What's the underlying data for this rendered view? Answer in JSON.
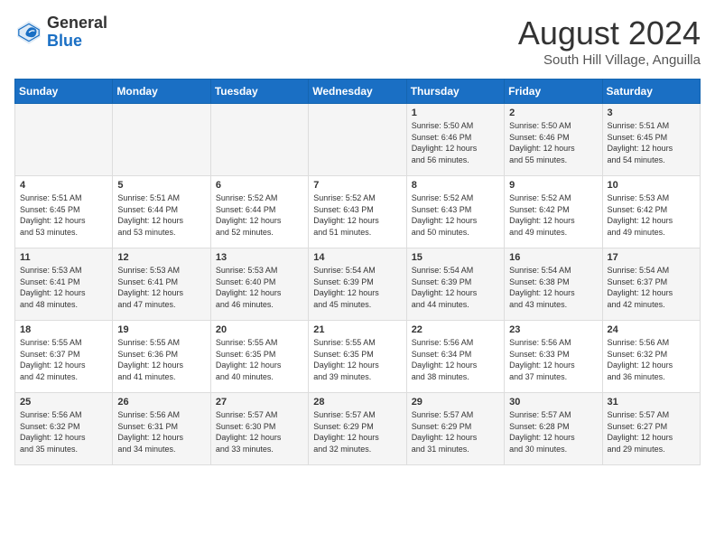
{
  "header": {
    "logo_general": "General",
    "logo_blue": "Blue",
    "month_year": "August 2024",
    "location": "South Hill Village, Anguilla"
  },
  "days_of_week": [
    "Sunday",
    "Monday",
    "Tuesday",
    "Wednesday",
    "Thursday",
    "Friday",
    "Saturday"
  ],
  "weeks": [
    [
      {
        "day": "",
        "info": ""
      },
      {
        "day": "",
        "info": ""
      },
      {
        "day": "",
        "info": ""
      },
      {
        "day": "",
        "info": ""
      },
      {
        "day": "1",
        "info": "Sunrise: 5:50 AM\nSunset: 6:46 PM\nDaylight: 12 hours\nand 56 minutes."
      },
      {
        "day": "2",
        "info": "Sunrise: 5:50 AM\nSunset: 6:46 PM\nDaylight: 12 hours\nand 55 minutes."
      },
      {
        "day": "3",
        "info": "Sunrise: 5:51 AM\nSunset: 6:45 PM\nDaylight: 12 hours\nand 54 minutes."
      }
    ],
    [
      {
        "day": "4",
        "info": "Sunrise: 5:51 AM\nSunset: 6:45 PM\nDaylight: 12 hours\nand 53 minutes."
      },
      {
        "day": "5",
        "info": "Sunrise: 5:51 AM\nSunset: 6:44 PM\nDaylight: 12 hours\nand 53 minutes."
      },
      {
        "day": "6",
        "info": "Sunrise: 5:52 AM\nSunset: 6:44 PM\nDaylight: 12 hours\nand 52 minutes."
      },
      {
        "day": "7",
        "info": "Sunrise: 5:52 AM\nSunset: 6:43 PM\nDaylight: 12 hours\nand 51 minutes."
      },
      {
        "day": "8",
        "info": "Sunrise: 5:52 AM\nSunset: 6:43 PM\nDaylight: 12 hours\nand 50 minutes."
      },
      {
        "day": "9",
        "info": "Sunrise: 5:52 AM\nSunset: 6:42 PM\nDaylight: 12 hours\nand 49 minutes."
      },
      {
        "day": "10",
        "info": "Sunrise: 5:53 AM\nSunset: 6:42 PM\nDaylight: 12 hours\nand 49 minutes."
      }
    ],
    [
      {
        "day": "11",
        "info": "Sunrise: 5:53 AM\nSunset: 6:41 PM\nDaylight: 12 hours\nand 48 minutes."
      },
      {
        "day": "12",
        "info": "Sunrise: 5:53 AM\nSunset: 6:41 PM\nDaylight: 12 hours\nand 47 minutes."
      },
      {
        "day": "13",
        "info": "Sunrise: 5:53 AM\nSunset: 6:40 PM\nDaylight: 12 hours\nand 46 minutes."
      },
      {
        "day": "14",
        "info": "Sunrise: 5:54 AM\nSunset: 6:39 PM\nDaylight: 12 hours\nand 45 minutes."
      },
      {
        "day": "15",
        "info": "Sunrise: 5:54 AM\nSunset: 6:39 PM\nDaylight: 12 hours\nand 44 minutes."
      },
      {
        "day": "16",
        "info": "Sunrise: 5:54 AM\nSunset: 6:38 PM\nDaylight: 12 hours\nand 43 minutes."
      },
      {
        "day": "17",
        "info": "Sunrise: 5:54 AM\nSunset: 6:37 PM\nDaylight: 12 hours\nand 42 minutes."
      }
    ],
    [
      {
        "day": "18",
        "info": "Sunrise: 5:55 AM\nSunset: 6:37 PM\nDaylight: 12 hours\nand 42 minutes."
      },
      {
        "day": "19",
        "info": "Sunrise: 5:55 AM\nSunset: 6:36 PM\nDaylight: 12 hours\nand 41 minutes."
      },
      {
        "day": "20",
        "info": "Sunrise: 5:55 AM\nSunset: 6:35 PM\nDaylight: 12 hours\nand 40 minutes."
      },
      {
        "day": "21",
        "info": "Sunrise: 5:55 AM\nSunset: 6:35 PM\nDaylight: 12 hours\nand 39 minutes."
      },
      {
        "day": "22",
        "info": "Sunrise: 5:56 AM\nSunset: 6:34 PM\nDaylight: 12 hours\nand 38 minutes."
      },
      {
        "day": "23",
        "info": "Sunrise: 5:56 AM\nSunset: 6:33 PM\nDaylight: 12 hours\nand 37 minutes."
      },
      {
        "day": "24",
        "info": "Sunrise: 5:56 AM\nSunset: 6:32 PM\nDaylight: 12 hours\nand 36 minutes."
      }
    ],
    [
      {
        "day": "25",
        "info": "Sunrise: 5:56 AM\nSunset: 6:32 PM\nDaylight: 12 hours\nand 35 minutes."
      },
      {
        "day": "26",
        "info": "Sunrise: 5:56 AM\nSunset: 6:31 PM\nDaylight: 12 hours\nand 34 minutes."
      },
      {
        "day": "27",
        "info": "Sunrise: 5:57 AM\nSunset: 6:30 PM\nDaylight: 12 hours\nand 33 minutes."
      },
      {
        "day": "28",
        "info": "Sunrise: 5:57 AM\nSunset: 6:29 PM\nDaylight: 12 hours\nand 32 minutes."
      },
      {
        "day": "29",
        "info": "Sunrise: 5:57 AM\nSunset: 6:29 PM\nDaylight: 12 hours\nand 31 minutes."
      },
      {
        "day": "30",
        "info": "Sunrise: 5:57 AM\nSunset: 6:28 PM\nDaylight: 12 hours\nand 30 minutes."
      },
      {
        "day": "31",
        "info": "Sunrise: 5:57 AM\nSunset: 6:27 PM\nDaylight: 12 hours\nand 29 minutes."
      }
    ]
  ]
}
